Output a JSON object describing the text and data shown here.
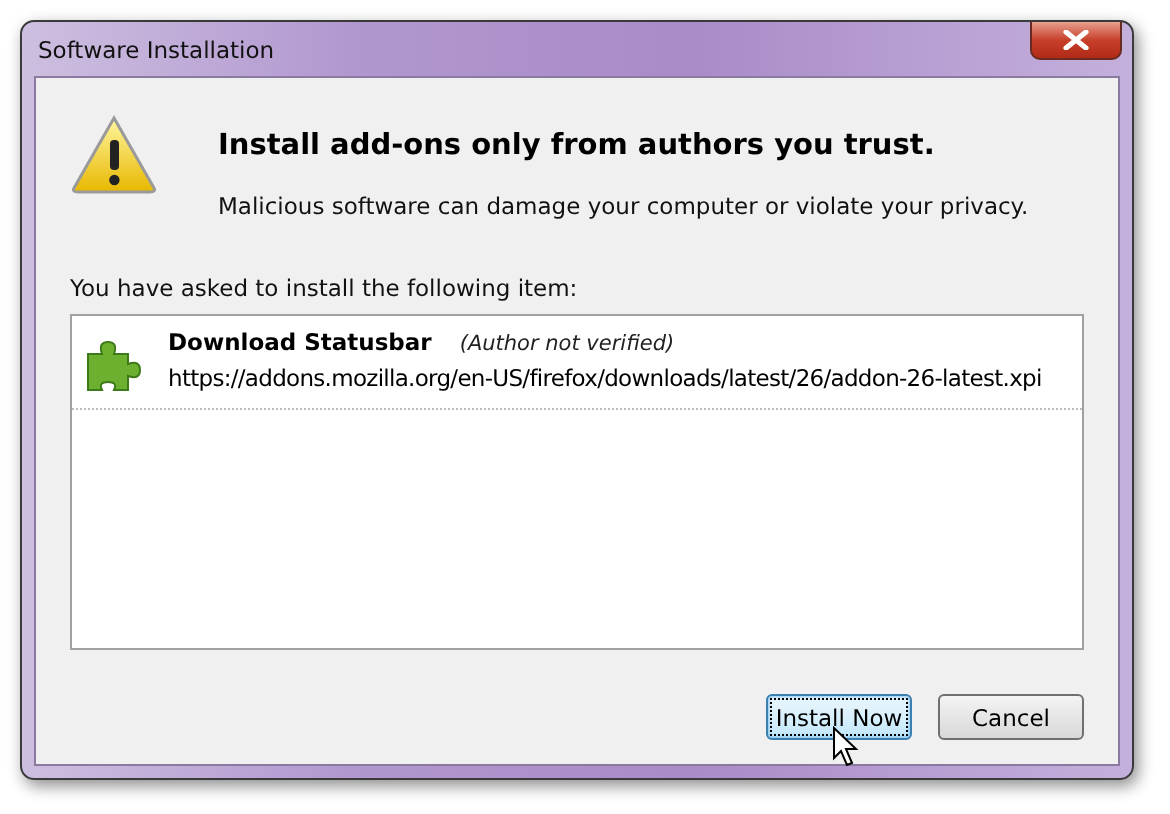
{
  "window": {
    "title": "Software Installation"
  },
  "heading": "Install add-ons only from authors you trust.",
  "message": "Malicious software can damage your computer or violate your privacy.",
  "list_label": "You have asked to install the following item:",
  "items": [
    {
      "name": "Download Statusbar",
      "note": "(Author not verified)",
      "url": "https://addons.mozilla.org/en-US/firefox/downloads/latest/26/addon-26-latest.xpi"
    }
  ],
  "buttons": [
    {
      "label": "Install Now",
      "focused": true
    },
    {
      "label": "Cancel",
      "focused": false
    }
  ]
}
